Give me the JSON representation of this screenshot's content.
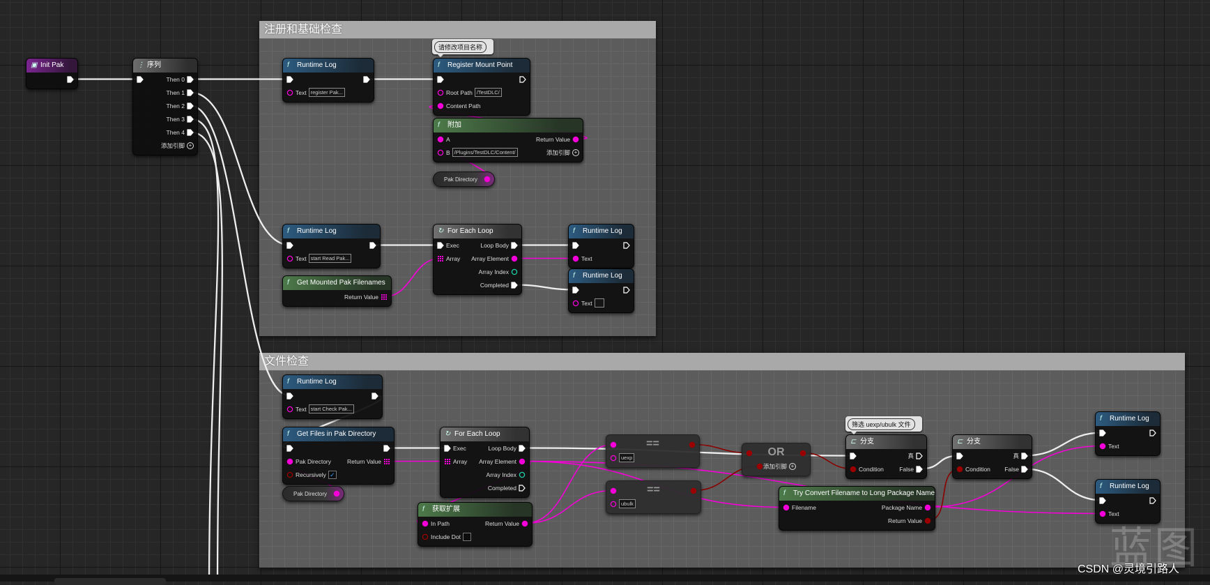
{
  "comments": [
    {
      "title": "注册和基础检查"
    },
    {
      "title": "文件检查"
    }
  ],
  "bubbles": [
    {
      "text": "请修改项目名称"
    },
    {
      "text": "筛选 uexp/ubulk 文件"
    }
  ],
  "header_colors": {
    "event": "#7b2590",
    "sequence": "#6d6d6d",
    "function": "#2d5b80",
    "pure": "#4d7a4a",
    "macro": "#707070"
  },
  "pin_colors": {
    "exec": "#ffffff",
    "string": "#f400d8",
    "array": "#f400d8",
    "int": "#1fd0a8",
    "bool": "#9a0000"
  },
  "nodes": [
    {
      "title": "Init Pak",
      "kind": "event",
      "icon": "event-icon",
      "inputs": [],
      "outputs": [
        {
          "type": "exec",
          "linked": true
        }
      ]
    },
    {
      "title": "序列",
      "kind": "sequence",
      "icon": "sequence-icon",
      "inputs": [
        {
          "type": "exec",
          "linked": true
        }
      ],
      "outputs": [
        {
          "label": "Then 0",
          "type": "exec",
          "linked": true
        },
        {
          "label": "Then 1",
          "type": "exec",
          "linked": true
        },
        {
          "label": "Then 2",
          "type": "exec",
          "linked": true
        },
        {
          "label": "Then 3",
          "type": "exec",
          "linked": true
        },
        {
          "label": "Then 4",
          "type": "exec",
          "linked": true
        },
        {
          "label": "添加引脚",
          "type": "add"
        }
      ]
    },
    {
      "title": "Runtime Log",
      "kind": "function",
      "icon": "function-icon",
      "inputs": [
        {
          "type": "exec",
          "linked": true
        },
        {
          "label": "Text",
          "type": "string",
          "linked": false,
          "value": "register Pak..."
        }
      ],
      "outputs": [
        {
          "type": "exec",
          "linked": true
        }
      ]
    },
    {
      "title": "Register Mount Point",
      "kind": "function",
      "icon": "function-icon",
      "inputs": [
        {
          "type": "exec",
          "linked": true
        },
        {
          "label": "Root Path",
          "type": "string",
          "linked": false,
          "value": "/TestDLC/"
        },
        {
          "label": "Content Path",
          "type": "string",
          "linked": true
        }
      ],
      "outputs": [
        {
          "type": "exec",
          "linked": false
        }
      ]
    },
    {
      "title": "附加",
      "kind": "pure",
      "icon": "function-icon",
      "inputs": [
        {
          "label": "A",
          "type": "string",
          "linked": true
        },
        {
          "label": "B",
          "type": "string",
          "linked": false,
          "value": "/Plugins/TestDLC/Content/"
        }
      ],
      "outputs": [
        {
          "label": "Return Value",
          "type": "string",
          "linked": true
        },
        {
          "label": "添加引脚",
          "type": "add"
        }
      ]
    },
    {
      "title": "Pak Directory",
      "kind": "variable",
      "outputs": [
        {
          "type": "string",
          "linked": true
        }
      ]
    },
    {
      "title": "Runtime Log",
      "kind": "function",
      "icon": "function-icon",
      "inputs": [
        {
          "type": "exec",
          "linked": true
        },
        {
          "label": "Text",
          "type": "string",
          "linked": false,
          "value": "start Read Pak..."
        }
      ],
      "outputs": [
        {
          "type": "exec",
          "linked": true
        }
      ]
    },
    {
      "title": "For Each Loop",
      "kind": "macro",
      "icon": "loop-icon",
      "inputs": [
        {
          "label": "Exec",
          "type": "exec",
          "linked": true
        },
        {
          "label": "Array",
          "type": "array",
          "linked": true
        }
      ],
      "outputs": [
        {
          "label": "Loop Body",
          "type": "exec",
          "linked": true
        },
        {
          "label": "Array Element",
          "type": "string",
          "linked": true
        },
        {
          "label": "Array Index",
          "type": "int",
          "linked": false
        },
        {
          "label": "Completed",
          "type": "exec",
          "linked": true
        }
      ]
    },
    {
      "title": "Get Mounted Pak Filenames",
      "kind": "pure",
      "icon": "function-icon",
      "inputs": [],
      "outputs": [
        {
          "label": "Return Value",
          "type": "array",
          "linked": true
        }
      ]
    },
    {
      "title": "Runtime Log",
      "kind": "function",
      "icon": "function-icon",
      "inputs": [
        {
          "type": "exec",
          "linked": true
        },
        {
          "label": "Text",
          "type": "string",
          "linked": true
        }
      ],
      "outputs": [
        {
          "type": "exec",
          "linked": false
        }
      ]
    },
    {
      "title": "Runtime Log",
      "kind": "function",
      "icon": "function-icon",
      "inputs": [
        {
          "type": "exec",
          "linked": true
        },
        {
          "label": "Text",
          "type": "string",
          "linked": false,
          "value": ""
        }
      ],
      "outputs": [
        {
          "type": "exec",
          "linked": false
        }
      ]
    },
    {
      "title": "Runtime Log",
      "kind": "function",
      "icon": "function-icon",
      "inputs": [
        {
          "type": "exec",
          "linked": true
        },
        {
          "label": "Text",
          "type": "string",
          "linked": false,
          "value": "start Check Pak..."
        }
      ],
      "outputs": [
        {
          "type": "exec",
          "linked": true
        }
      ]
    },
    {
      "title": "Get Files in Pak Directory",
      "kind": "function",
      "icon": "function-icon",
      "inputs": [
        {
          "type": "exec",
          "linked": true
        },
        {
          "label": "Pak Directory",
          "type": "string",
          "linked": true
        },
        {
          "label": "Recursively",
          "type": "bool",
          "linked": false,
          "checked": true
        }
      ],
      "outputs": [
        {
          "type": "exec",
          "linked": true
        },
        {
          "label": "Return Value",
          "type": "array",
          "linked": true
        }
      ]
    },
    {
      "title": "Pak Directory",
      "kind": "variable",
      "outputs": [
        {
          "type": "string",
          "linked": true
        }
      ]
    },
    {
      "title": "For Each Loop",
      "kind": "macro",
      "icon": "loop-icon",
      "inputs": [
        {
          "label": "Exec",
          "type": "exec",
          "linked": true
        },
        {
          "label": "Array",
          "type": "array",
          "linked": true
        }
      ],
      "outputs": [
        {
          "label": "Loop Body",
          "type": "exec",
          "linked": true
        },
        {
          "label": "Array Element",
          "type": "string",
          "linked": true
        },
        {
          "label": "Array Index",
          "type": "int",
          "linked": false
        },
        {
          "label": "Completed",
          "type": "exec",
          "linked": false
        }
      ]
    },
    {
      "title": "获取扩展",
      "kind": "pure",
      "icon": "function-icon",
      "inputs": [
        {
          "label": "In Path",
          "type": "string",
          "linked": true
        },
        {
          "label": "Include Dot",
          "type": "bool",
          "linked": false,
          "checked": false
        }
      ],
      "outputs": [
        {
          "label": "Return Value",
          "type": "string",
          "linked": true
        }
      ]
    },
    {
      "title": "==",
      "kind": "compact",
      "inputs": [
        {
          "type": "string",
          "linked": true
        },
        {
          "type": "string",
          "linked": false,
          "value": "uexp"
        }
      ],
      "outputs": [
        {
          "type": "bool",
          "linked": true
        }
      ]
    },
    {
      "title": "==",
      "kind": "compact",
      "inputs": [
        {
          "type": "string",
          "linked": true
        },
        {
          "type": "string",
          "linked": false,
          "value": "ubulk"
        }
      ],
      "outputs": [
        {
          "type": "bool",
          "linked": true
        }
      ]
    },
    {
      "title": "OR",
      "kind": "compact",
      "inputs": [
        {
          "type": "bool",
          "linked": true
        },
        {
          "type": "bool",
          "linked": true
        }
      ],
      "outputs": [
        {
          "type": "bool",
          "linked": true
        },
        {
          "label": "添加引脚",
          "type": "add"
        }
      ]
    },
    {
      "title": "分支",
      "kind": "macro",
      "icon": "branch-icon",
      "inputs": [
        {
          "type": "exec",
          "linked": true
        },
        {
          "label": "Condition",
          "type": "bool",
          "linked": true
        }
      ],
      "outputs": [
        {
          "label": "真",
          "type": "exec",
          "linked": false
        },
        {
          "label": "False",
          "type": "exec",
          "linked": true
        }
      ]
    },
    {
      "title": "分支",
      "kind": "macro",
      "icon": "branch-icon",
      "inputs": [
        {
          "type": "exec",
          "linked": true
        },
        {
          "label": "Condition",
          "type": "bool",
          "linked": true
        }
      ],
      "outputs": [
        {
          "label": "真",
          "type": "exec",
          "linked": true
        },
        {
          "label": "False",
          "type": "exec",
          "linked": true
        }
      ]
    },
    {
      "title": "Try Convert Filename to Long Package Name",
      "kind": "pure",
      "icon": "function-icon",
      "inputs": [
        {
          "label": "Filename",
          "type": "string",
          "linked": true
        }
      ],
      "outputs": [
        {
          "label": "Package Name",
          "type": "string",
          "linked": true
        },
        {
          "label": "Return Value",
          "type": "bool",
          "linked": true
        }
      ]
    },
    {
      "title": "Runtime Log",
      "kind": "function",
      "icon": "function-icon",
      "inputs": [
        {
          "type": "exec",
          "linked": true
        },
        {
          "label": "Text",
          "type": "string",
          "linked": true
        }
      ],
      "outputs": [
        {
          "type": "exec",
          "linked": false
        }
      ]
    },
    {
      "title": "Runtime Log",
      "kind": "function",
      "icon": "function-icon",
      "inputs": [
        {
          "type": "exec",
          "linked": true
        },
        {
          "label": "Text",
          "type": "string",
          "linked": true
        }
      ],
      "outputs": [
        {
          "type": "exec",
          "linked": false
        }
      ]
    }
  ],
  "watermark": {
    "logo": "蓝图",
    "credit": "CSDN @灵境引路人"
  }
}
